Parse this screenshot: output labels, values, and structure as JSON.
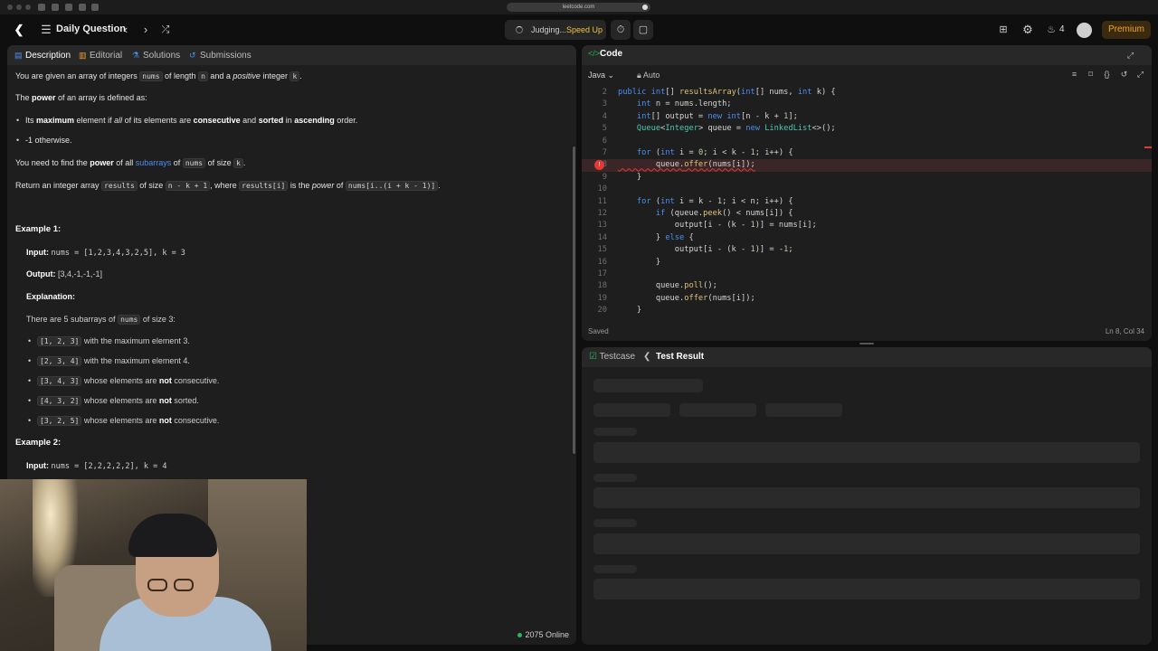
{
  "browser": {
    "url": "leetcode.com"
  },
  "topnav": {
    "title": "Daily Question",
    "judging": "Judging...",
    "speed_up": "Speed Up",
    "streak_count": "4",
    "premium": "Premium"
  },
  "left_tabs": [
    {
      "label": "Description",
      "icon": "document-icon"
    },
    {
      "label": "Editorial",
      "icon": "book-icon"
    },
    {
      "label": "Solutions",
      "icon": "flask-icon"
    },
    {
      "label": "Submissions",
      "icon": "history-icon"
    }
  ],
  "description": {
    "p1": [
      "You are given an array of integers ",
      "nums",
      " of length ",
      "n",
      " and a ",
      "positive",
      " integer ",
      "k",
      "."
    ],
    "p2": [
      "The ",
      "power",
      " of an array is defined as:"
    ],
    "b1": [
      "Its ",
      "maximum",
      " element if ",
      "all",
      " of its elements are ",
      "consecutive",
      " and ",
      "sorted",
      " in ",
      "ascending",
      " order."
    ],
    "b2": "-1 otherwise.",
    "p3": [
      "You need to find the ",
      "power",
      " of all ",
      "subarrays",
      " of ",
      "nums",
      " of size ",
      "k",
      "."
    ],
    "p4": [
      "Return an integer array ",
      "results",
      " of size ",
      "n - k + 1",
      ", where ",
      "results[i]",
      " is the ",
      "power",
      " of ",
      "nums[i..(i + k - 1)]",
      "."
    ],
    "example1": {
      "title": "Example 1:",
      "input_label": "Input:",
      "input": "nums = [1,2,3,4,3,2,5], k = 3",
      "output_label": "Output:",
      "output": "[3,4,-1,-1,-1]",
      "explanation_label": "Explanation:",
      "expl_intro": [
        "There are 5 subarrays of ",
        "nums",
        " of size 3:"
      ],
      "items": [
        {
          "code": "[1, 2, 3]",
          "text_a": " with the maximum element 3.",
          "bold": "",
          "text_b": ""
        },
        {
          "code": "[2, 3, 4]",
          "text_a": " with the maximum element 4.",
          "bold": "",
          "text_b": ""
        },
        {
          "code": "[3, 4, 3]",
          "text_a": " whose elements are ",
          "bold": "not",
          "text_b": " consecutive."
        },
        {
          "code": "[4, 3, 2]",
          "text_a": " whose elements are ",
          "bold": "not",
          "text_b": " sorted."
        },
        {
          "code": "[3, 2, 5]",
          "text_a": " whose elements are ",
          "bold": "not",
          "text_b": " consecutive."
        }
      ]
    },
    "example2": {
      "title": "Example 2:",
      "input_label": "Input:",
      "input": "nums = [2,2,2,2,2], k = 4"
    }
  },
  "online": "2075 Online",
  "code": {
    "title": "Code",
    "language": "Java",
    "mode": "Auto",
    "lines": [
      {
        "n": "2",
        "html": "<span class=\"kw\">public</span> <span class=\"kw\">int</span>[] <span class=\"fn\">resultsArray</span>(<span class=\"kw\">int</span>[] nums, <span class=\"kw\">int</span> k) {"
      },
      {
        "n": "3",
        "html": "    <span class=\"kw\">int</span> n = nums.length;"
      },
      {
        "n": "4",
        "html": "    <span class=\"kw\">int</span>[] output = <span class=\"kw\">new</span> <span class=\"kw\">int</span>[n - k + <span class=\"nm\">1</span>];"
      },
      {
        "n": "5",
        "html": "    <span class=\"ty\">Queue</span>&lt;<span class=\"ty\">Integer</span>&gt; queue = <span class=\"kw\">new</span> <span class=\"ty\">LinkedList</span>&lt;&gt;();"
      },
      {
        "n": "6",
        "html": ""
      },
      {
        "n": "7",
        "html": "    <span class=\"kw\">for</span> (<span class=\"kw\">int</span> i = <span class=\"nm\">0</span>; i &lt; k - <span class=\"nm\">1</span>; i++) {"
      },
      {
        "n": "8",
        "html": "        queue.<span class=\"fn\">offer</span>(nums[i]);",
        "error": true
      },
      {
        "n": "9",
        "html": "    }"
      },
      {
        "n": "10",
        "html": ""
      },
      {
        "n": "11",
        "html": "    <span class=\"kw\">for</span> (<span class=\"kw\">int</span> i = k - <span class=\"nm\">1</span>; i &lt; n; i++) {"
      },
      {
        "n": "12",
        "html": "        <span class=\"kw\">if</span> (queue.<span class=\"fn\">peek</span>() &lt; nums[i]) {"
      },
      {
        "n": "13",
        "html": "            output[i - (k - <span class=\"nm\">1</span>)] = nums[i];"
      },
      {
        "n": "14",
        "html": "        } <span class=\"kw\">else</span> {"
      },
      {
        "n": "15",
        "html": "            output[i - (k - <span class=\"nm\">1</span>)] = -<span class=\"nm\">1</span>;"
      },
      {
        "n": "16",
        "html": "        }"
      },
      {
        "n": "17",
        "html": ""
      },
      {
        "n": "18",
        "html": "        queue.<span class=\"fn\">poll</span>();"
      },
      {
        "n": "19",
        "html": "        queue.<span class=\"fn\">offer</span>(nums[i]);"
      },
      {
        "n": "20",
        "html": "    }"
      }
    ],
    "status_saved": "Saved",
    "cursor": "Ln 8, Col 34"
  },
  "test": {
    "testcase_tab": "Testcase",
    "result_tab": "Test Result"
  }
}
